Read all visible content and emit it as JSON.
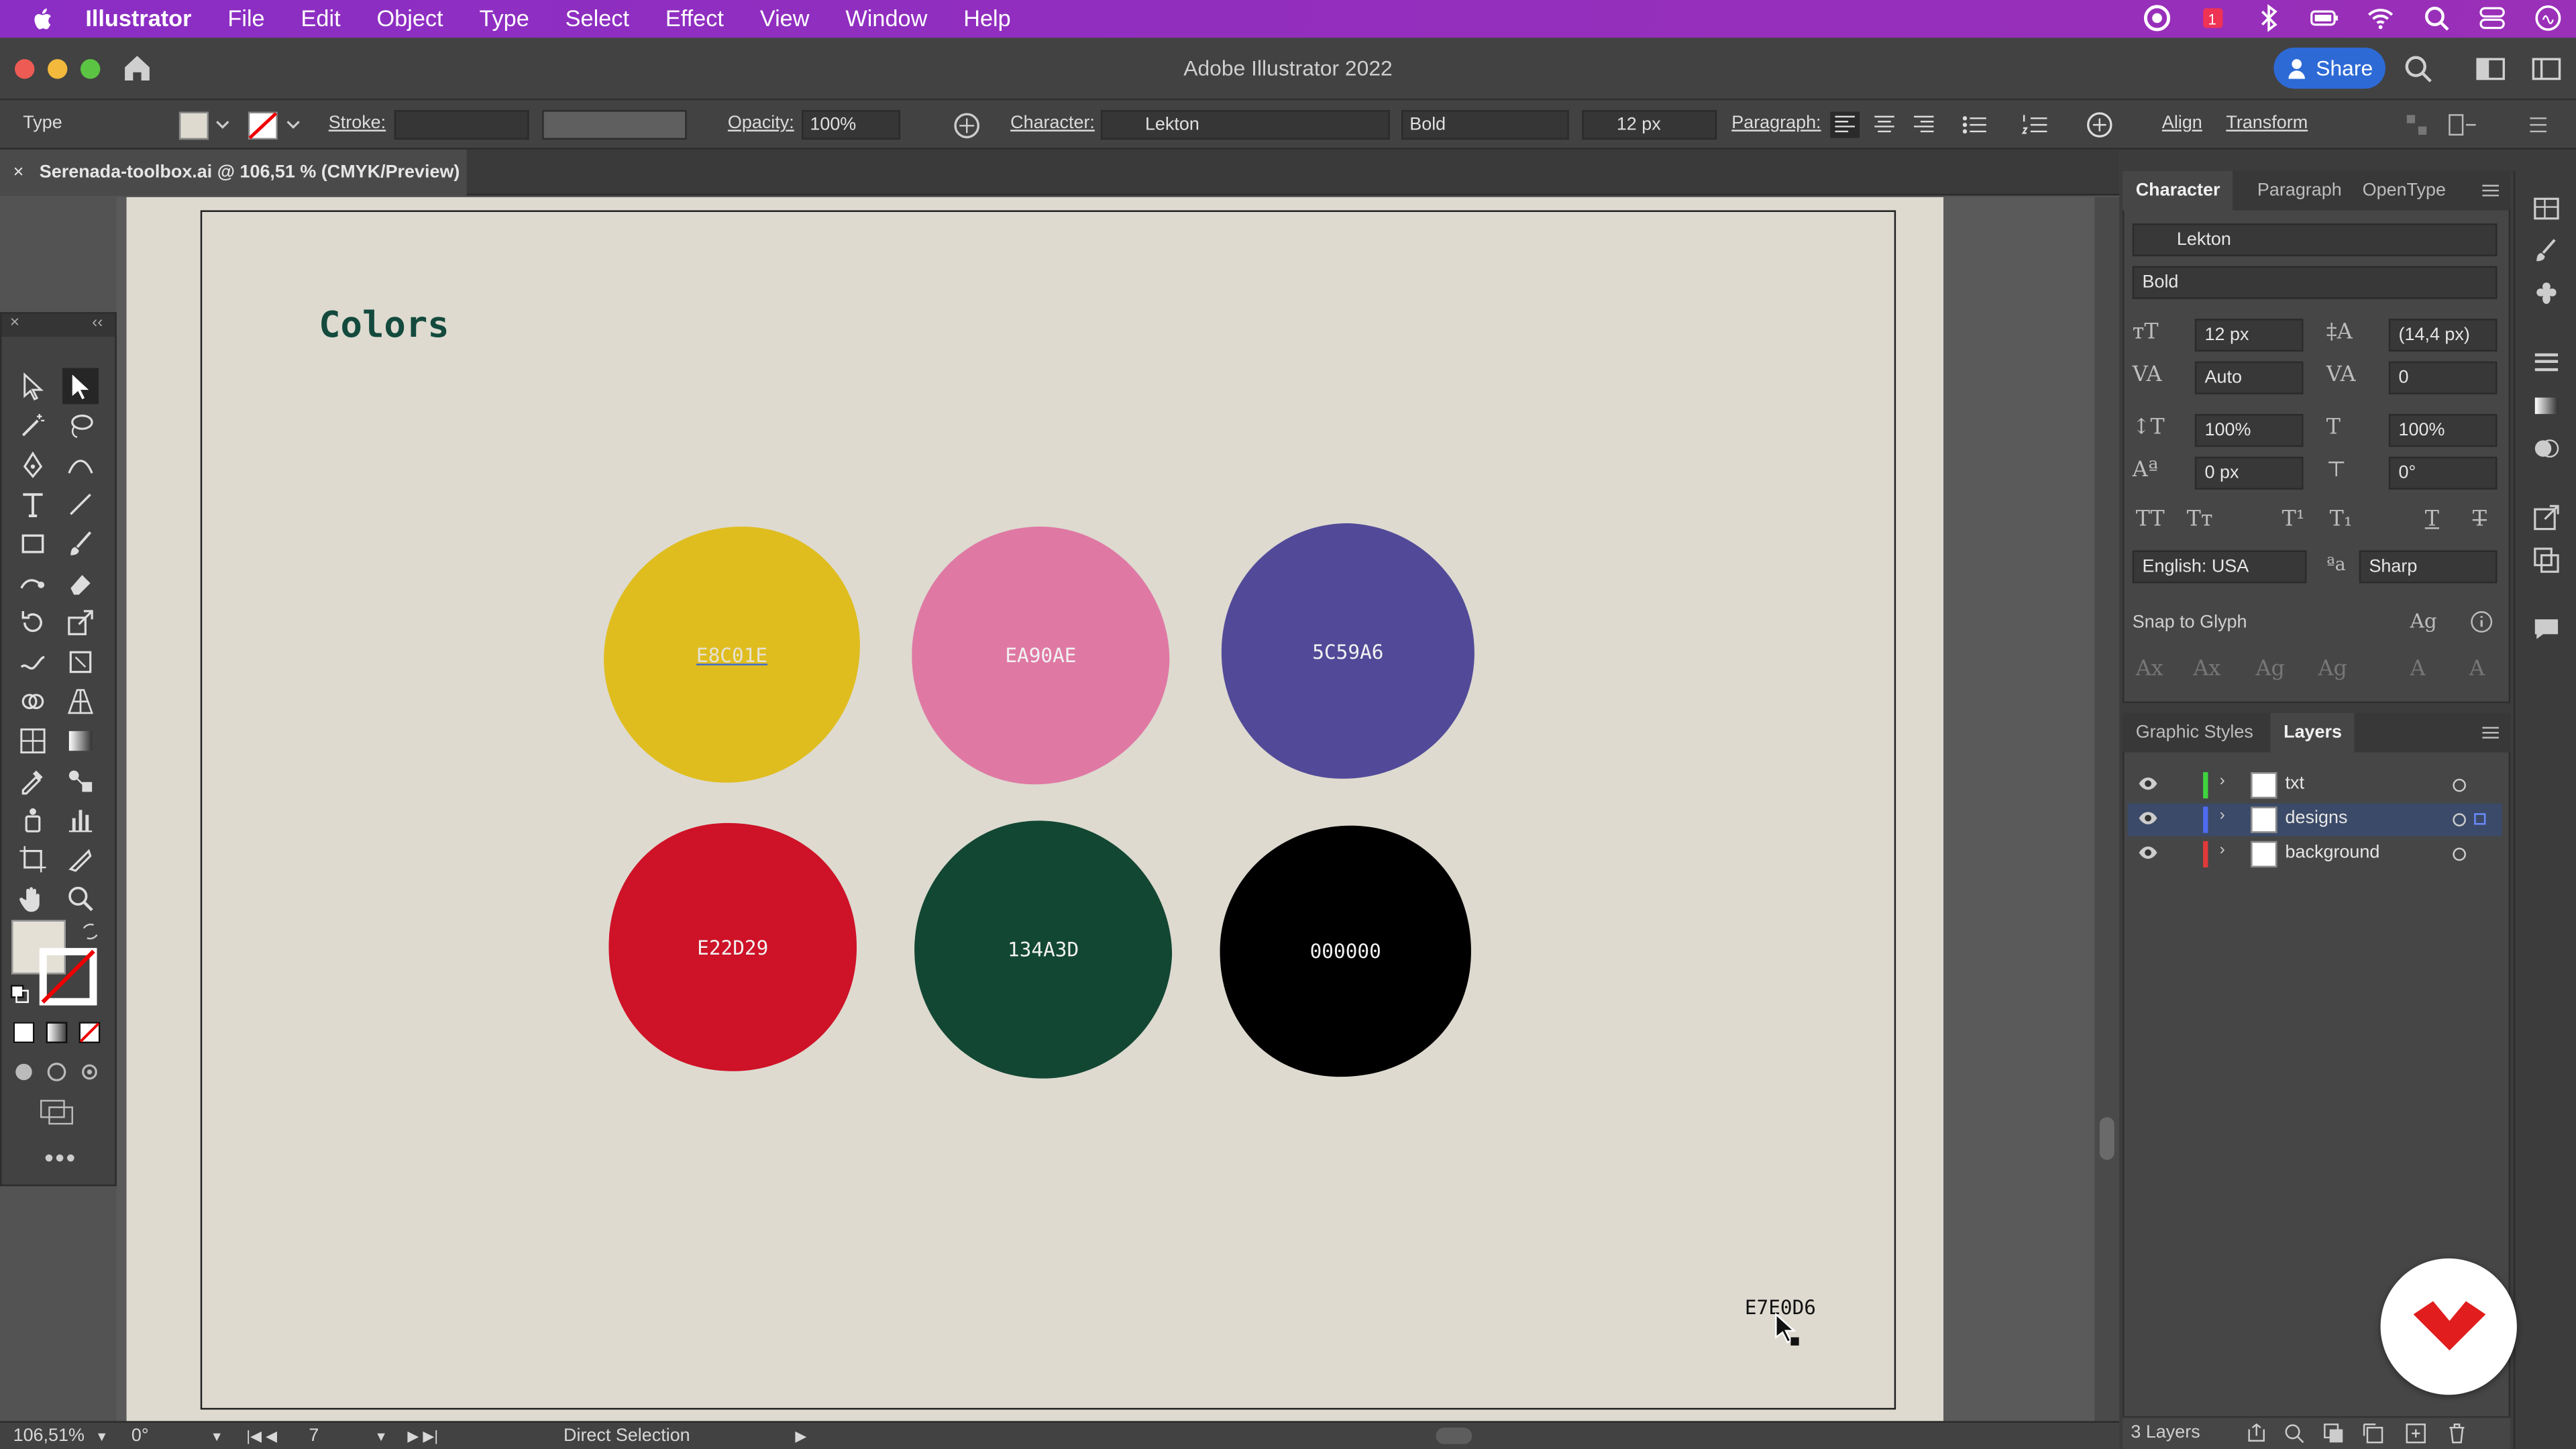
{
  "menubar": {
    "app": "Illustrator",
    "items": [
      "File",
      "Edit",
      "Object",
      "Type",
      "Select",
      "Effect",
      "View",
      "Window",
      "Help"
    ]
  },
  "window": {
    "title": "Adobe Illustrator 2022",
    "share_label": "Share"
  },
  "control": {
    "tool_label": "Type",
    "stroke_label": "Stroke:",
    "opacity_label": "Opacity:",
    "opacity_value": "100%",
    "character_label": "Character:",
    "font": "Lekton",
    "style": "Bold",
    "size": "12 px",
    "paragraph_label": "Paragraph:",
    "align_label": "Align",
    "transform_label": "Transform"
  },
  "document": {
    "tab": "Serenada-toolbox.ai @ 106,51 % (CMYK/Preview)",
    "heading": "Colors",
    "swatches": [
      {
        "hex": "E8C01E",
        "color": "#dfbd1f"
      },
      {
        "hex": "EA90AE",
        "color": "#df79a4"
      },
      {
        "hex": "5C59A6",
        "color": "#524a98"
      },
      {
        "hex": "E22D29",
        "color": "#ce1227"
      },
      {
        "hex": "134A3D",
        "color": "#124733"
      },
      {
        "hex": "000000",
        "color": "#000000"
      }
    ],
    "cursor_text": "E7E0D6"
  },
  "status": {
    "zoom": "106,51%",
    "rotation": "0°",
    "artboard": "7",
    "tool": "Direct Selection"
  },
  "character_panel": {
    "tabs": [
      "Character",
      "Paragraph",
      "OpenType"
    ],
    "font": "Lekton",
    "style": "Bold",
    "size": "12 px",
    "leading": "(14,4 px)",
    "kerning": "Auto",
    "tracking": "0",
    "vscale": "100%",
    "hscale": "100%",
    "baseline": "0 px",
    "rotation": "0°",
    "language": "English: USA",
    "aa": "Sharp",
    "snap_label": "Snap to Glyph"
  },
  "layers_panel": {
    "tabs": [
      "Graphic Styles",
      "Layers"
    ],
    "layers": [
      {
        "name": "txt",
        "color": "#3fd43f"
      },
      {
        "name": "designs",
        "color": "#4f6cf0"
      },
      {
        "name": "background",
        "color": "#e23a3a"
      }
    ],
    "count": "3 Layers"
  }
}
